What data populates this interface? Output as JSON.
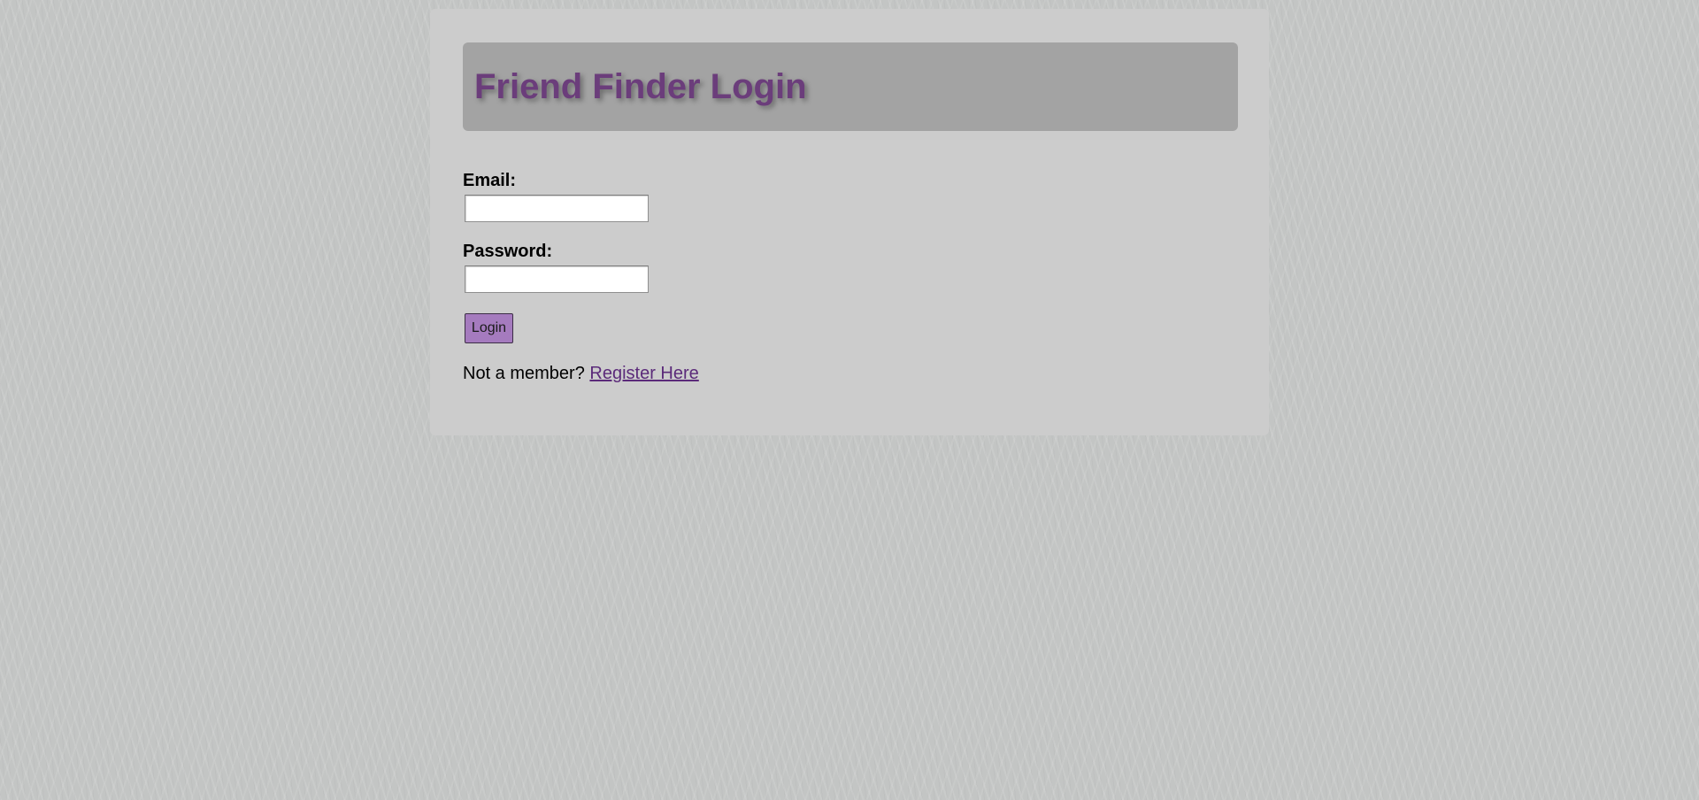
{
  "page": {
    "title": "Friend Finder Login"
  },
  "form": {
    "email_label": "Email:",
    "email_value": "",
    "password_label": "Password:",
    "password_value": "",
    "login_label": "Login"
  },
  "register": {
    "prompt": "Not a member?",
    "link_text": "Register Here"
  },
  "colors": {
    "background": "#c3c5c4",
    "panel": "#cccccc",
    "header_bar": "#a3a3a3",
    "title_text": "#6b3d7b",
    "button": "#a57bbe",
    "link": "#5b2a7a"
  }
}
